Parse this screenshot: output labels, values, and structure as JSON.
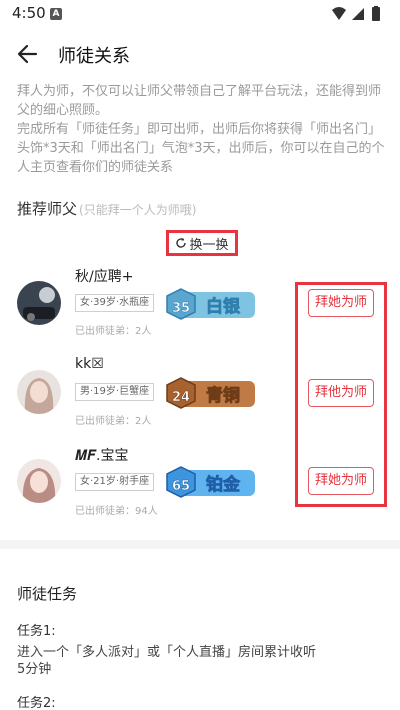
{
  "status_bar": {
    "time": "4:50",
    "notification_glyph": "A"
  },
  "header": {
    "title": "师徒关系"
  },
  "intro": {
    "line1": "拜人为师，不仅可以让师父带领自己了解平台玩法，还能得到师父的细心照顾。",
    "line2": "完成所有「师徒任务」即可出师，出师后你将获得「师出名门」头饰*3天和「师出名门」气泡*3天，出师后，你可以在自己的个人主页查看你们的师徒关系"
  },
  "recommend": {
    "title": "推荐师父",
    "note": "(只能拜一个人为师哦)",
    "refresh_label": "换一换"
  },
  "mentors": [
    {
      "name": "秋/应聘+",
      "tag": "女·39岁·水瓶座",
      "count": "已出师徒弟：2人",
      "level": "35",
      "rank": "白银",
      "button": "拜她为师",
      "badge_color": "#6fb4d8",
      "rank_color": "#ffffff"
    },
    {
      "name": "kk☒",
      "tag": "男·19岁·巨蟹座",
      "count": "已出师徒弟：2人",
      "level": "24",
      "rank": "青铜",
      "button": "拜他为师",
      "badge_color": "#b5733f",
      "rank_color": "#ffffff"
    },
    {
      "name": "𝑴𝑭.宝宝",
      "tag": "女·21岁·射手座",
      "count": "已出师徒弟：94人",
      "level": "65",
      "rank": "铂金",
      "button": "拜她为师",
      "badge_color": "#4ba3e6",
      "rank_color": "#ffffff"
    }
  ],
  "tasks": {
    "title": "师徒任务",
    "task1_label": "任务1:",
    "task1_desc": "进入一个「多人派对」或「个人直播」房间累计收听5分钟",
    "task2_label": "任务2:"
  },
  "colors": {
    "accent_red": "#e8343f",
    "muted_text": "#9a9a9a"
  }
}
